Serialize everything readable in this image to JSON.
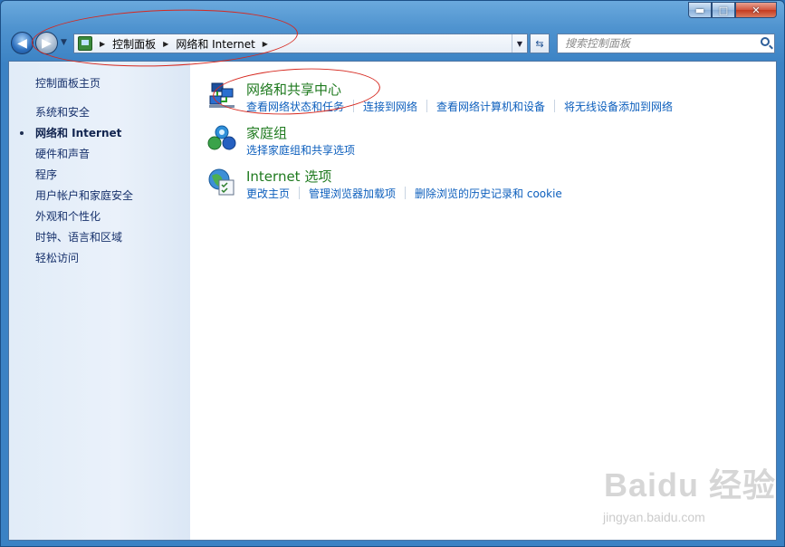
{
  "window": {
    "controls": {
      "minimize": "▬",
      "maximize": "□",
      "close": "✕"
    }
  },
  "nav": {
    "back_icon": "arrow-left-icon",
    "forward_icon": "arrow-right-icon",
    "breadcrumb": [
      "控制面板",
      "网络和 Internet"
    ],
    "search_placeholder": "搜索控制面板"
  },
  "sidebar": {
    "home": "控制面板主页",
    "items": [
      {
        "label": "系统和安全",
        "active": false
      },
      {
        "label": "网络和 Internet",
        "active": true
      },
      {
        "label": "硬件和声音",
        "active": false
      },
      {
        "label": "程序",
        "active": false
      },
      {
        "label": "用户帐户和家庭安全",
        "active": false
      },
      {
        "label": "外观和个性化",
        "active": false
      },
      {
        "label": "时钟、语言和区域",
        "active": false
      },
      {
        "label": "轻松访问",
        "active": false
      }
    ]
  },
  "categories": [
    {
      "title": "网络和共享中心",
      "icon": "network-center-icon",
      "links": [
        "查看网络状态和任务",
        "连接到网络",
        "查看网络计算机和设备",
        "将无线设备添加到网络"
      ]
    },
    {
      "title": "家庭组",
      "icon": "homegroup-icon",
      "links": [
        "选择家庭组和共享选项"
      ]
    },
    {
      "title": "Internet 选项",
      "icon": "internet-options-icon",
      "links": [
        "更改主页",
        "管理浏览器加载项",
        "删除浏览的历史记录和 cookie"
      ]
    }
  ],
  "watermark": {
    "brand": "Baidu 经验",
    "url": "jingyan.baidu.com"
  },
  "colors": {
    "link": "#0d5fbd",
    "category_title": "#1f7a1f",
    "annotation": "#d6281f"
  }
}
